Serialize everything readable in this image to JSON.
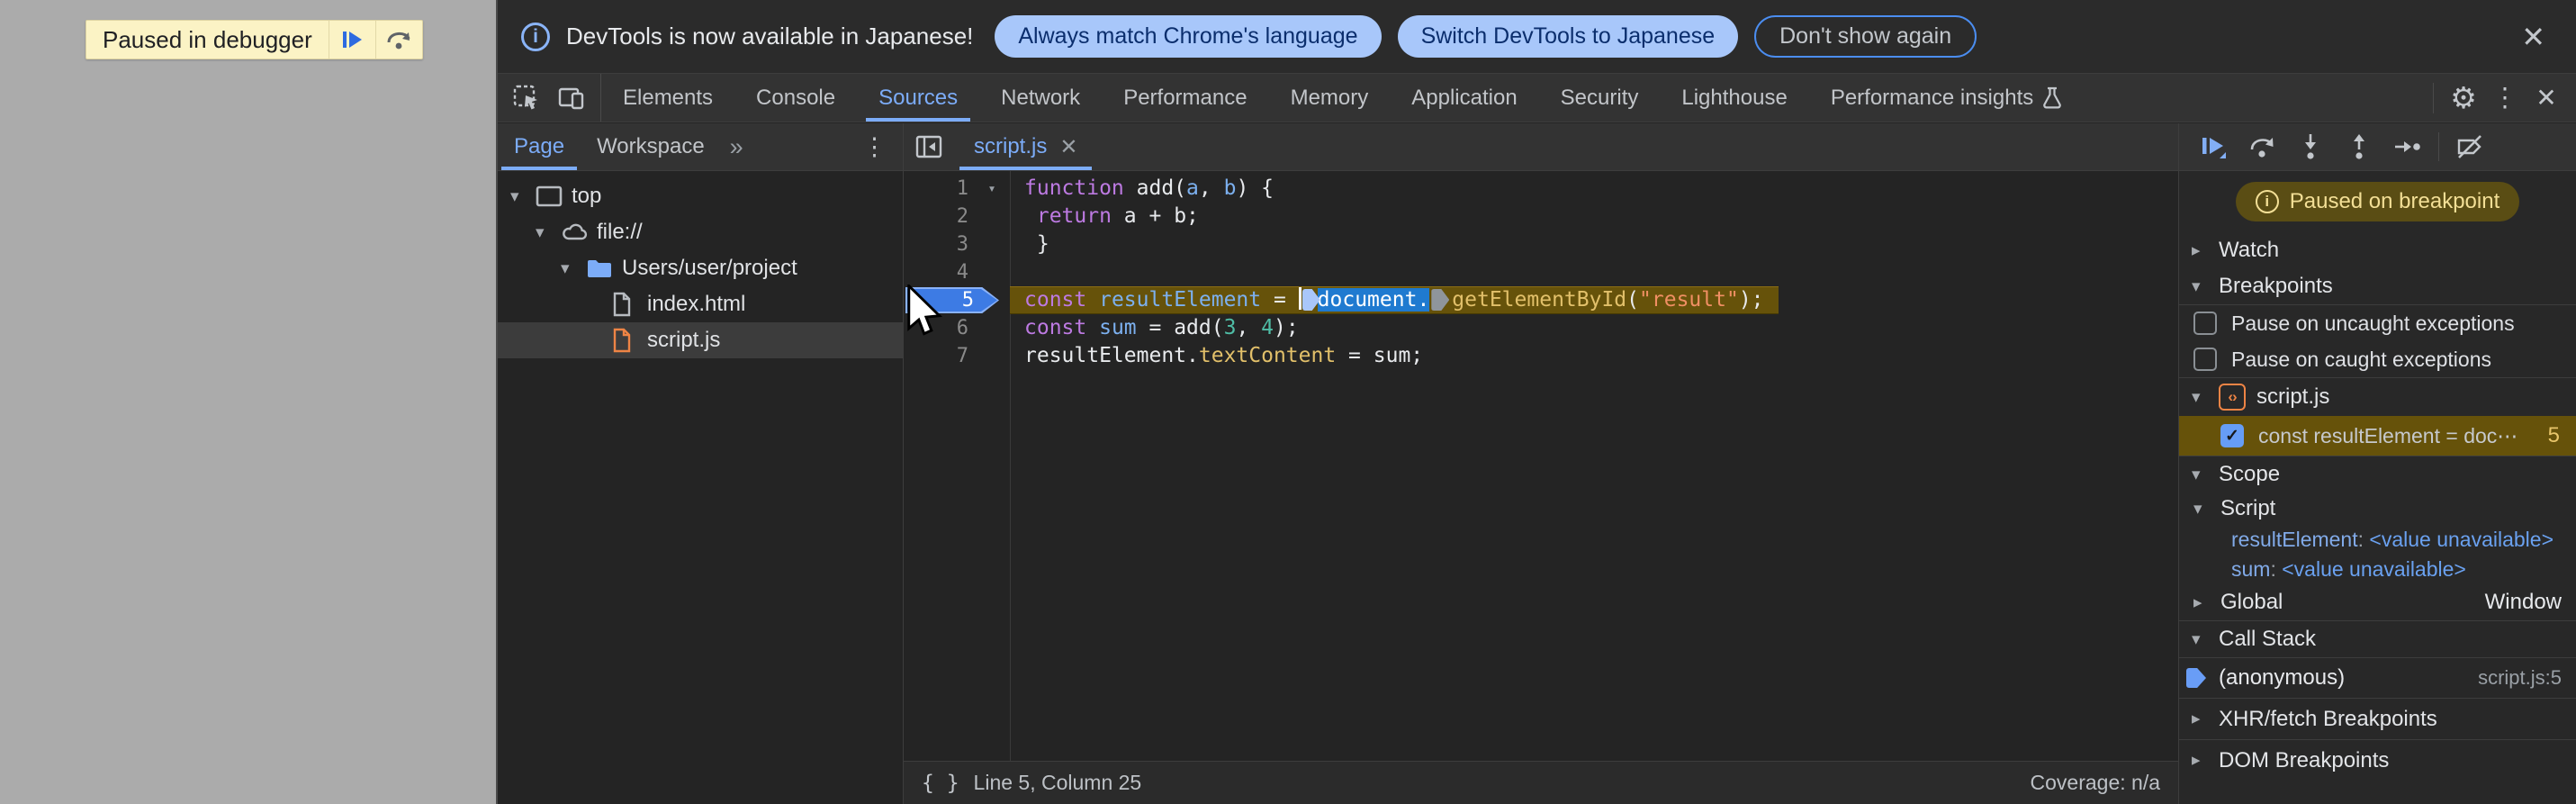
{
  "colors": {
    "accent_blue": "#7cacf8",
    "selection_blue": "#1f7ad0",
    "paused_line_bg": "#66520a",
    "paused_badge_bg": "#5a4d14",
    "paused_badge_text": "#f3df96",
    "banner_bg": "#fbf3c5",
    "js_orange": "#ee8445",
    "folder_blue": "#7cacf8",
    "exec_marker_blue": "#3d7be4",
    "pill_bg": "#a8c7fa",
    "pill_text": "#0b2e6d",
    "keyword": "#bd7ae2",
    "variable": "#7cb0ef",
    "property": "#e2c06a",
    "string": "#f08f63",
    "number": "#4fbda6"
  },
  "icons": {
    "kebab": "⋮",
    "more_tabs": "»",
    "close": "✕",
    "gear": "⚙",
    "tri_down": "▾",
    "tri_right": "▸",
    "format": "{ }",
    "info": "i",
    "check": "✓",
    "js_badge": "‹›"
  },
  "page": {
    "paused_banner": {
      "label": "Paused in debugger"
    }
  },
  "notification": {
    "message": "DevTools is now available in Japanese!",
    "actions": [
      {
        "label": "Always match Chrome's language",
        "style": "filled"
      },
      {
        "label": "Switch DevTools to Japanese",
        "style": "filled"
      },
      {
        "label": "Don't show again",
        "style": "outlined"
      }
    ]
  },
  "main_tabs": {
    "active": "Sources",
    "items": [
      {
        "label": "Elements"
      },
      {
        "label": "Console"
      },
      {
        "label": "Sources"
      },
      {
        "label": "Network"
      },
      {
        "label": "Performance"
      },
      {
        "label": "Memory"
      },
      {
        "label": "Application"
      },
      {
        "label": "Security"
      },
      {
        "label": "Lighthouse"
      },
      {
        "label": "Performance insights",
        "trailing_icon": "flask-icon"
      }
    ]
  },
  "navigator": {
    "tabs": [
      {
        "label": "Page",
        "active": true
      },
      {
        "label": "Workspace",
        "active": false
      }
    ],
    "tree": [
      {
        "label": "top",
        "icon": "frame-icon",
        "level": 0,
        "expanded": true
      },
      {
        "label": "file://",
        "icon": "cloud-icon",
        "level": 1,
        "expanded": true
      },
      {
        "label": "Users/user/project",
        "icon": "folder-icon",
        "level": 2,
        "expanded": true
      },
      {
        "label": "index.html",
        "icon": "html-file-icon",
        "level": 3
      },
      {
        "label": "script.js",
        "icon": "js-file-icon",
        "level": 3,
        "selected": true
      }
    ]
  },
  "editor": {
    "tab": {
      "label": "script.js"
    },
    "status": {
      "position": "Line 5, Column 25",
      "coverage": "Coverage: n/a"
    },
    "code": {
      "lines": [
        {
          "num": 1,
          "fold": true,
          "tokens": [
            {
              "t": "function",
              "s": "kw"
            },
            {
              "t": " add(",
              "s": "pl"
            },
            {
              "t": "a",
              "s": "var"
            },
            {
              "t": ", ",
              "s": "pl"
            },
            {
              "t": "b",
              "s": "var"
            },
            {
              "t": ") {",
              "s": "pl"
            }
          ]
        },
        {
          "num": 2,
          "tokens": [
            {
              "t": " ",
              "s": "pl"
            },
            {
              "t": "return",
              "s": "kw"
            },
            {
              "t": " a + b;",
              "s": "pl"
            }
          ]
        },
        {
          "num": 3,
          "tokens": [
            {
              "t": " }",
              "s": "pl"
            }
          ]
        },
        {
          "num": 4,
          "tokens": []
        },
        {
          "num": 5,
          "paused": true,
          "tokens": [
            {
              "t": "const",
              "s": "kw"
            },
            {
              "t": " ",
              "s": "pl"
            },
            {
              "t": "resultElement",
              "s": "var"
            },
            {
              "t": " = ",
              "s": "pl"
            },
            {
              "s": "caret"
            },
            {
              "s": "cm1"
            },
            {
              "t": "document.",
              "s": "sel"
            },
            {
              "s": "cm2"
            },
            {
              "t": "getElementById",
              "s": "prop"
            },
            {
              "t": "(",
              "s": "pl"
            },
            {
              "t": "\"result\"",
              "s": "str"
            },
            {
              "t": ");",
              "s": "pl"
            }
          ]
        },
        {
          "num": 6,
          "tokens": [
            {
              "t": "const",
              "s": "kw"
            },
            {
              "t": " ",
              "s": "pl"
            },
            {
              "t": "sum",
              "s": "var"
            },
            {
              "t": " = add(",
              "s": "pl"
            },
            {
              "t": "3",
              "s": "num"
            },
            {
              "t": ", ",
              "s": "pl"
            },
            {
              "t": "4",
              "s": "num"
            },
            {
              "t": ");",
              "s": "pl"
            }
          ]
        },
        {
          "num": 7,
          "tokens": [
            {
              "t": "resultElement.",
              "s": "pl"
            },
            {
              "t": "textContent",
              "s": "prop"
            },
            {
              "t": " = sum;",
              "s": "pl"
            }
          ]
        }
      ]
    }
  },
  "debugger": {
    "paused_message": "Paused on breakpoint",
    "watch_label": "Watch",
    "breakpoints": {
      "label": "Breakpoints",
      "options": [
        {
          "label": "Pause on uncaught exceptions",
          "checked": false
        },
        {
          "label": "Pause on caught exceptions",
          "checked": false
        }
      ],
      "file_group": {
        "file": "script.js",
        "entry": {
          "snippet": "const resultElement = doc⋯",
          "line": "5",
          "checked": true
        }
      }
    },
    "scope": {
      "label": "Scope",
      "script": {
        "label": "Script",
        "vars": [
          {
            "name": "resultElement",
            "value": "<value unavailable>"
          },
          {
            "name": "sum",
            "value": "<value unavailable>"
          }
        ]
      },
      "global": {
        "label": "Global",
        "value": "Window"
      }
    },
    "call_stack": {
      "label": "Call Stack",
      "frames": [
        {
          "name": "(anonymous)",
          "location": "script.js:5",
          "active": true
        }
      ]
    },
    "xhr_label": "XHR/fetch Breakpoints",
    "dom_label": "DOM Breakpoints"
  }
}
